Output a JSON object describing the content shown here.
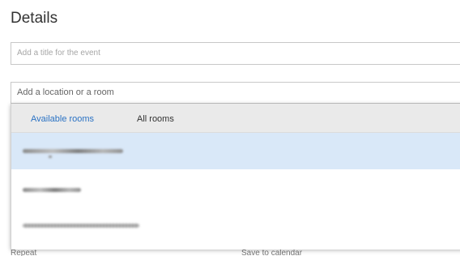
{
  "details": {
    "heading": "Details"
  },
  "title_field": {
    "placeholder": "Add a title for the event",
    "value": ""
  },
  "location_field": {
    "placeholder": "Add a location or a room",
    "value": ""
  },
  "room_dropdown": {
    "tabs": [
      {
        "label": "Available rooms",
        "active": true
      },
      {
        "label": "All rooms",
        "active": false
      }
    ],
    "rooms_redacted_count": 3,
    "colors": {
      "active_tab": "#2a72c4",
      "tab_bar_bg": "#eaeaea",
      "selected_row_bg": "#d9e8f8"
    }
  },
  "under_labels": {
    "left": "Repeat",
    "right": "Save to calendar"
  }
}
